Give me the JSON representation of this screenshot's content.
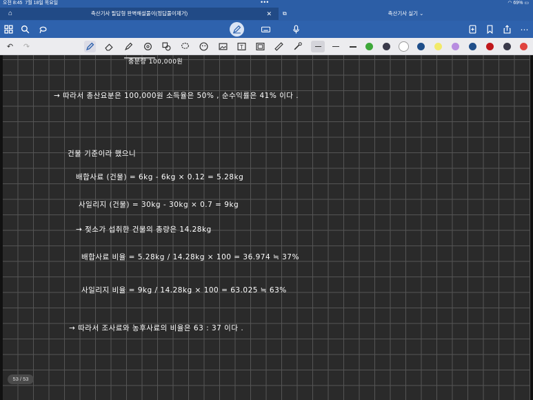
{
  "status": {
    "time": "오전 8:45",
    "date": "7월 18일 목요일",
    "battery": "69%"
  },
  "tabs": [
    {
      "title": "축산기사 필답형 완벽해설풀이(정답풀이제거)",
      "active": true
    },
    {
      "title": "축산기사 실기",
      "active": false
    }
  ],
  "topbar_icons": [
    "grid-icon",
    "search-icon",
    "lasso-icon",
    "pen-mode-icon",
    "keyboard-icon",
    "microphone-icon",
    "add-page-icon",
    "bookmark-icon",
    "share-icon",
    "more-icon"
  ],
  "toolbar": {
    "tools": [
      "undo-icon",
      "redo-icon",
      "pen-icon",
      "eraser-icon",
      "highlighter-icon",
      "shape-icon",
      "element-icon",
      "lasso-select-icon",
      "sticker-icon",
      "image-icon",
      "text-icon",
      "camera-icon",
      "ruler-icon",
      "laser-icon"
    ],
    "colors": [
      "#3ea83a",
      "#3a3a4a",
      "#ffffff",
      "#1f4e8a",
      "#f2ea6a",
      "#b88de0",
      "#1f4e8a",
      "#c0181c",
      "#3a3a4a",
      "#e0443f"
    ],
    "selected_color_index": 2
  },
  "notes": [
    {
      "id": "line-0",
      "text": "충분량                    100,000원"
    },
    {
      "id": "line-1",
      "text": "→  따라서  총산요분은   100,000원    소득율은  50% , 순수익률은  41% 이다 ."
    },
    {
      "id": "line-2",
      "text": "건물 기준이라  했으니"
    },
    {
      "id": "line-3",
      "text": "배합사료 (건물) = 6kg -  6kg × 0.12  =  5.28kg"
    },
    {
      "id": "line-4",
      "text": "사일리지 (건물) =  30kg  - 30kg × 0.7  =  9kg"
    },
    {
      "id": "line-5",
      "text": "→  젖소가  섭취한  건물의 총량은  14.28kg"
    },
    {
      "id": "line-6",
      "text": "배합사료 비율  =   5.28kg / 14.28kg  × 100  =  36.974  ≒  37%"
    },
    {
      "id": "line-7",
      "text": "사일리지 비율  =   9kg / 14.28kg  × 100  =  63.025  ≒  63%"
    },
    {
      "id": "line-8",
      "text": "→  따라서   조사료와  농후사료의  비율은  63 : 37 이다 ."
    }
  ],
  "page_indicator": "53 / 53"
}
